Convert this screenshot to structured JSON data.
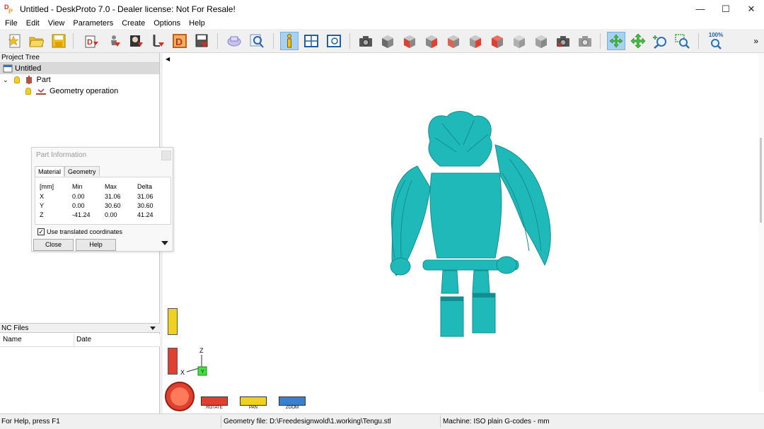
{
  "window": {
    "title": "Untitled - DeskProto 7.0 - Dealer license: Not For Resale!",
    "logo_text_d": "D",
    "logo_text_p": "P",
    "controls": [
      "—",
      "☐",
      "✕"
    ]
  },
  "menu": [
    "File",
    "Edit",
    "View",
    "Parameters",
    "Create",
    "Options",
    "Help"
  ],
  "toolbar": {
    "more": "»",
    "zoom_label": "100%",
    "icons": [
      "new-project-icon",
      "open-icon",
      "save-icon",
      "import-part-icon",
      "import-geometry-icon",
      "import-bitmap-icon",
      "import-vector-icon",
      "dxf-icon",
      "save-view-icon",
      "tools-icon",
      "simulation-icon",
      "info-icon",
      "views-icon",
      "screens-icon",
      "camera-icon",
      "cube-default-icon",
      "cube-front-icon",
      "cube-back-icon",
      "cube-left-icon",
      "cube-right-icon",
      "cube-top-icon",
      "cube-bottom-icon",
      "cube-iso-icon",
      "camera-settings-icon",
      "camera-reset-icon",
      "rotate-icon",
      "pan-icon",
      "zoom-in-icon",
      "zoom-window-icon",
      "zoom-100-icon"
    ]
  },
  "project_tree": {
    "header": "Project Tree",
    "items": [
      {
        "label": "Untitled",
        "selected": true
      },
      {
        "label": "Part"
      },
      {
        "label": "Geometry operation"
      }
    ]
  },
  "nc_files": {
    "header": "NC Files",
    "columns": [
      "Name",
      "Date"
    ]
  },
  "part_info": {
    "title": "Part Information",
    "tabs": [
      "Material",
      "Geometry"
    ],
    "table": {
      "header": [
        "[mm]",
        "Min",
        "Max",
        "Delta"
      ],
      "rows": [
        [
          "X",
          "0.00",
          "31.06",
          "31.06"
        ],
        [
          "Y",
          "0.00",
          "30.60",
          "30.60"
        ],
        [
          "Z",
          "-41.24",
          "0.00",
          "41.24"
        ]
      ]
    },
    "checkbox_label": "Use translated coordinates",
    "checkbox_checked": true,
    "close_label": "Close",
    "help_label": "Help"
  },
  "axis": {
    "x": "X",
    "y": "Y",
    "z": "Z"
  },
  "view_controls": {
    "rotate": "ROTATE",
    "pan": "PAN",
    "zoom": "ZOOM"
  },
  "status": {
    "help": "For Help, press F1",
    "geometry": "Geometry file: D:\\Freedesignwold\\1.working\\Tengu.stl",
    "machine": "Machine: ISO plain G-codes - mm"
  },
  "colors": {
    "model": "#1fb9ba",
    "model_shadow": "#138e90",
    "selection": "#d9d9d9",
    "active_tool": "#a8d0f0"
  }
}
